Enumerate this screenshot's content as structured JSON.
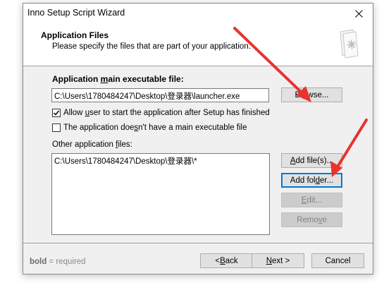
{
  "window": {
    "title": "Inno Setup Script Wizard",
    "close_label": "✕"
  },
  "header": {
    "title": "Application Files",
    "subtitle": "Please specify the files that are part of your application."
  },
  "main_exe": {
    "label_pre": "Application ",
    "label_ul": "m",
    "label_post": "ain executable file:",
    "value": "C:\\Users\\1780484247\\Desktop\\登录器\\launcher.exe",
    "browse_pre": "Br",
    "browse_post": "wse..."
  },
  "options": {
    "allow_user_pre": "Allow ",
    "allow_user_ul": "u",
    "allow_user_post": "ser to start the application after Setup has finished",
    "allow_user_checked": true,
    "no_main_pre": "The application doe",
    "no_main_ul": "s",
    "no_main_post": "n't have a main executable file",
    "no_main_checked": false
  },
  "other_files": {
    "label_pre": "Other application ",
    "label_ul": "f",
    "label_post": "iles:",
    "items": [
      "C:\\Users\\1780484247\\Desktop\\登录器\\*"
    ],
    "add_files_pre": "",
    "add_files_ul": "A",
    "add_files_post": "dd file(s)...",
    "add_folder_pre": "Add fol",
    "add_folder_ul": "d",
    "add_folder_post": "er...",
    "edit_pre": "",
    "edit_ul": "E",
    "edit_post": "dit...",
    "remove_pre": "Remo",
    "remove_ul": "v",
    "remove_post": "e"
  },
  "footer": {
    "hint_bold": "bold",
    "hint_rest": " = required",
    "back_pre": "< ",
    "back_ul": "B",
    "back_post": "ack",
    "next_ul": "N",
    "next_post": "ext >",
    "cancel": "Cancel"
  },
  "colors": {
    "annotation_arrow": "#e8332e",
    "default_button_border": "#0078d7"
  }
}
